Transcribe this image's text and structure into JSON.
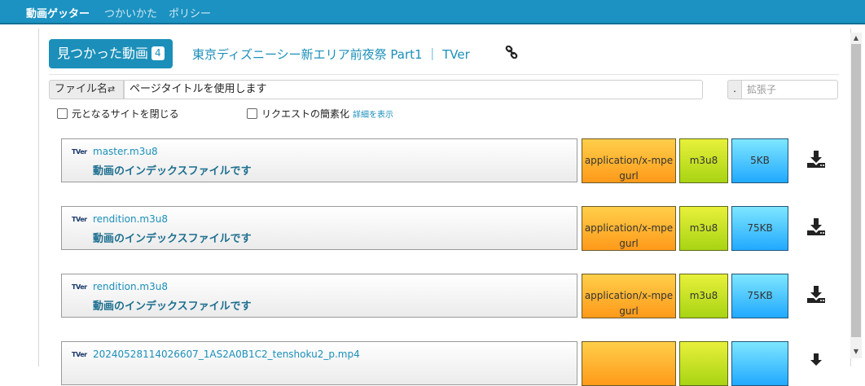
{
  "nav": {
    "brand": "動画ゲッター",
    "links": [
      "つかいかた",
      "ポリシー"
    ]
  },
  "header": {
    "found_label": "見つかった動画",
    "found_count": "4",
    "page_title": "東京ディズニーシー新エリア前夜祭 Part1 ｜ TVer",
    "link_icon": "chain-link-icon"
  },
  "filename": {
    "label": "ファイル名",
    "toggle_icon": "swap-arrows-icon",
    "value": "ページタイトルを使用します"
  },
  "extension": {
    "dot": ".",
    "placeholder": "拡張子"
  },
  "options": {
    "close_site": "元となるサイトを閉じる",
    "simplify_request": "リクエストの簡素化",
    "details_link": "詳細を表示"
  },
  "files": [
    {
      "site_icon": "TVer",
      "name": "master.m3u8",
      "description": "動画のインデックスファイルです",
      "mime": "application/x-mpegurl",
      "ext": "m3u8",
      "size": "5KB"
    },
    {
      "site_icon": "TVer",
      "name": "rendition.m3u8",
      "description": "動画のインデックスファイルです",
      "mime": "application/x-mpegurl",
      "ext": "m3u8",
      "size": "75KB"
    },
    {
      "site_icon": "TVer",
      "name": "rendition.m3u8",
      "description": "動画のインデックスファイルです",
      "mime": "application/x-mpegurl",
      "ext": "m3u8",
      "size": "75KB"
    },
    {
      "site_icon": "TVer",
      "name": "20240528114026607_1AS2A0B1C2_tenshoku2_p.mp4",
      "description": "",
      "mime": "",
      "ext": "",
      "size": ""
    }
  ],
  "colors": {
    "navbar": "#1b92c1",
    "accent": "#1b8fba",
    "mime_box": "#ffb020",
    "ext_box": "#c8e226",
    "size_box": "#4cc4ff"
  }
}
